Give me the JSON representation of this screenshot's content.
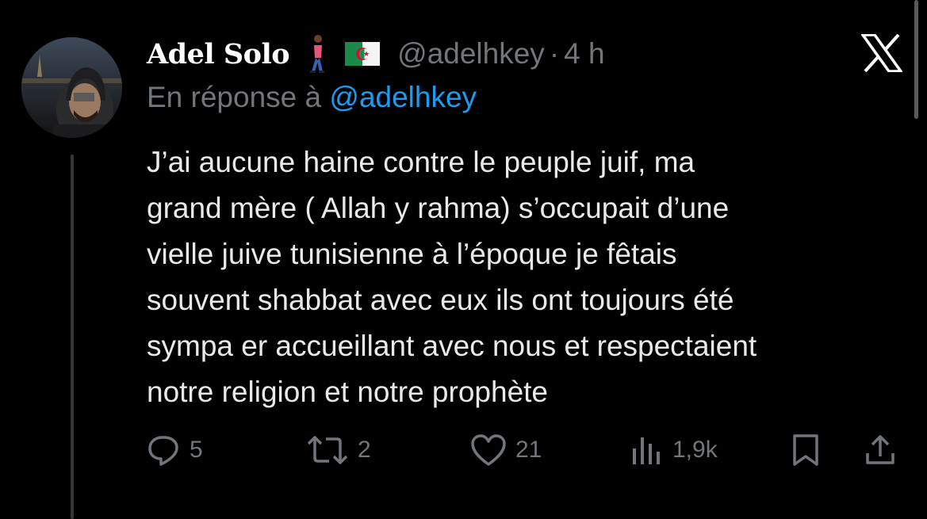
{
  "tweet": {
    "author_name": "Adel Solo",
    "emoji_walker": "person-walking-emoji",
    "emoji_flag": "algeria-flag-emoji",
    "handle": "@adelhkey",
    "separator": "·",
    "time": "4 h",
    "reply_prefix": "En réponse à",
    "reply_handle": "@adelhkey",
    "text_lines": [
      "J’ai aucune haine contre le peuple juif, ma",
      "grand mère ( Allah y rahma) s’occupait d’une",
      "vielle juive tunisienne à l’époque je fêtais",
      "souvent shabbat avec eux ils ont toujours été",
      "sympa er accueillant avec nous et respectaient",
      "notre religion et notre prophète"
    ]
  },
  "actions": {
    "reply": {
      "icon": "reply-icon",
      "count": "5"
    },
    "retweet": {
      "icon": "retweet-icon",
      "count": "2"
    },
    "like": {
      "icon": "heart-icon",
      "count": "21"
    },
    "views": {
      "icon": "views-icon",
      "count": "1,9k"
    },
    "bookmark": {
      "icon": "bookmark-icon"
    },
    "share": {
      "icon": "share-icon"
    }
  },
  "colors": {
    "background": "#000000",
    "text": "#e7e9ea",
    "muted": "#71767b",
    "link": "#1d9bf0"
  }
}
